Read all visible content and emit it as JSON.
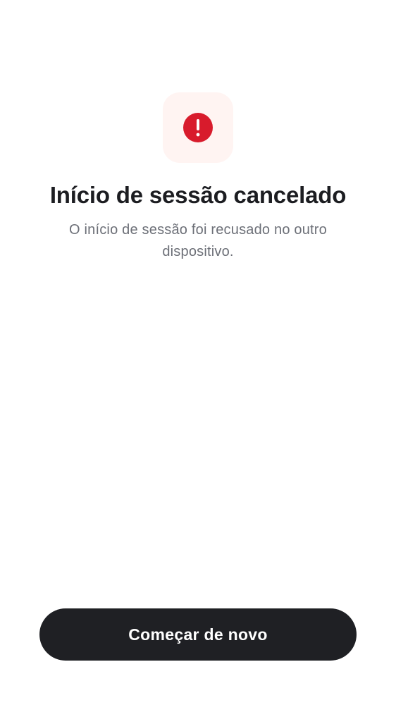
{
  "status": {
    "icon": "alert-circle-icon",
    "icon_color": "#d81b2c",
    "tile_color": "#fff4f2"
  },
  "title": "Início de sessão cancelado",
  "subtitle": "O início de sessão foi recusado no outro dispositivo.",
  "actions": {
    "restart_label": "Começar de novo"
  }
}
